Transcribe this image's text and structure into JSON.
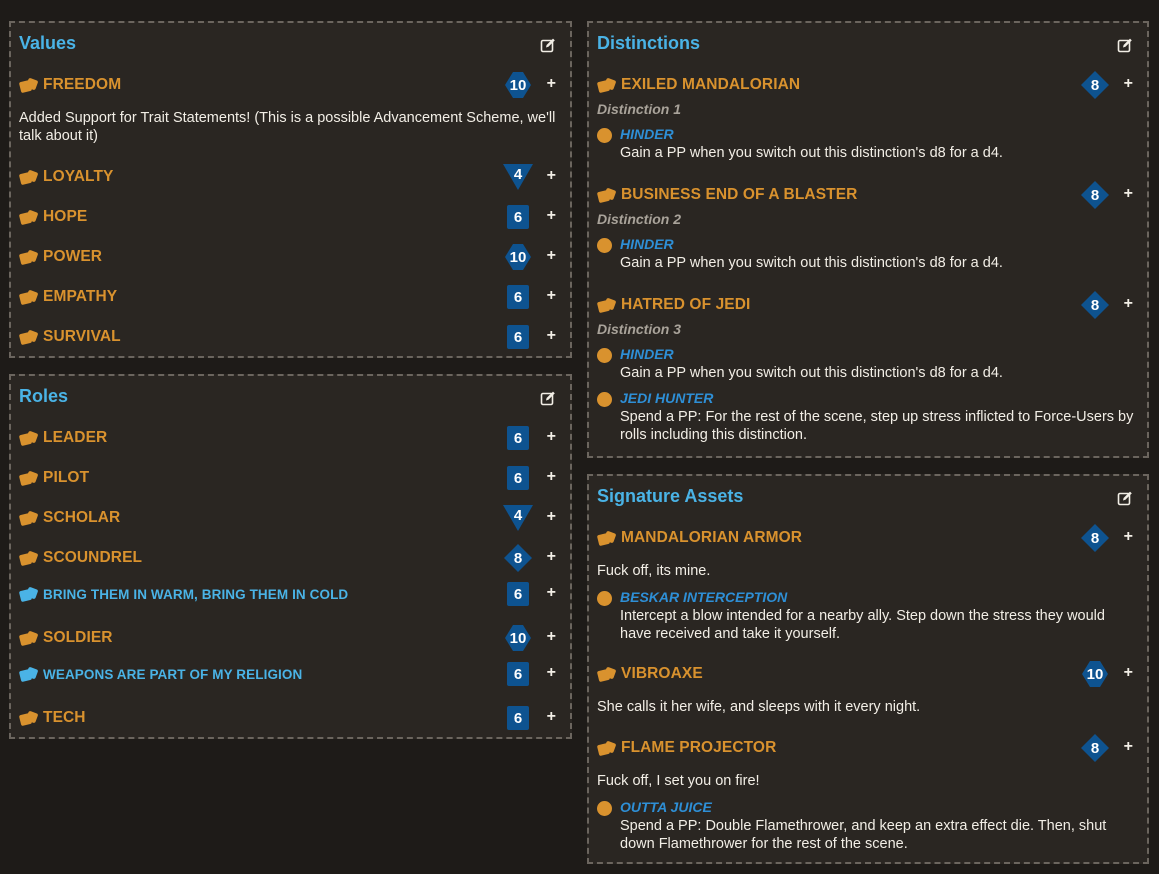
{
  "values": {
    "title": "Values",
    "items": [
      {
        "name": "FREEDOM",
        "die": "10"
      },
      {
        "name": "LOYALTY",
        "die": "4"
      },
      {
        "name": "HOPE",
        "die": "6"
      },
      {
        "name": "POWER",
        "die": "10"
      },
      {
        "name": "EMPATHY",
        "die": "6"
      },
      {
        "name": "SURVIVAL",
        "die": "6"
      }
    ],
    "freedom_note": "Added Support for Trait Statements! (This is a possible Advancement Scheme, we'll talk about it)"
  },
  "roles": {
    "title": "Roles",
    "items": [
      {
        "name": "LEADER",
        "die": "6"
      },
      {
        "name": "PILOT",
        "die": "6"
      },
      {
        "name": "SCHOLAR",
        "die": "4"
      },
      {
        "name": "SCOUNDREL",
        "die": "8"
      },
      {
        "name": "BRING THEM IN WARM, BRING THEM IN COLD",
        "die": "6"
      },
      {
        "name": "SOLDIER",
        "die": "10"
      },
      {
        "name": "WEAPONS ARE PART OF MY RELIGION",
        "die": "6"
      },
      {
        "name": "TECH",
        "die": "6"
      }
    ]
  },
  "distinctions": {
    "title": "Distinctions",
    "items": [
      {
        "name": "EXILED MANDALORIAN",
        "die": "8",
        "subtitle": "Distinction 1",
        "sfx": [
          {
            "name": "HINDER",
            "text": "Gain a PP when you switch out this distinction's d8 for a d4."
          }
        ]
      },
      {
        "name": "BUSINESS END OF A BLASTER",
        "die": "8",
        "subtitle": "Distinction 2",
        "sfx": [
          {
            "name": "HINDER",
            "text": "Gain a PP when you switch out this distinction's d8 for a d4."
          }
        ]
      },
      {
        "name": "HATRED OF JEDI",
        "die": "8",
        "subtitle": "Distinction 3",
        "sfx": [
          {
            "name": "HINDER",
            "text": "Gain a PP when you switch out this distinction's d8 for a d4."
          },
          {
            "name": "JEDI HUNTER",
            "text": "Spend a PP: For the rest of the scene, step up stress inflicted to Force-Users by rolls including this distinction."
          }
        ]
      }
    ]
  },
  "assets": {
    "title": "Signature Assets",
    "items": [
      {
        "name": "MANDALORIAN ARMOR",
        "die": "8",
        "note": "Fuck off, its mine.",
        "sfx": [
          {
            "name": "BESKAR INTERCEPTION",
            "text": "Intercept a blow intended for a nearby ally. Step down the stress they would have received and take it yourself."
          }
        ]
      },
      {
        "name": "VIBROAXE",
        "die": "10",
        "note": "She calls it her wife, and sleeps with it every night."
      },
      {
        "name": "FLAME PROJECTOR",
        "die": "8",
        "note": "Fuck off, I set you on fire!",
        "sfx": [
          {
            "name": "OUTTA JUICE",
            "text": "Spend a PP: Double Flamethrower, and keep an extra effect die. Then, shut down Flamethrower for the rest of the scene."
          }
        ]
      }
    ]
  },
  "colors": {
    "accent_blue": "#4ab3e6",
    "trait_orange": "#d9922e",
    "die_blue": "#0e5390",
    "background": "#1e1b18",
    "panel": "#2a2622"
  }
}
